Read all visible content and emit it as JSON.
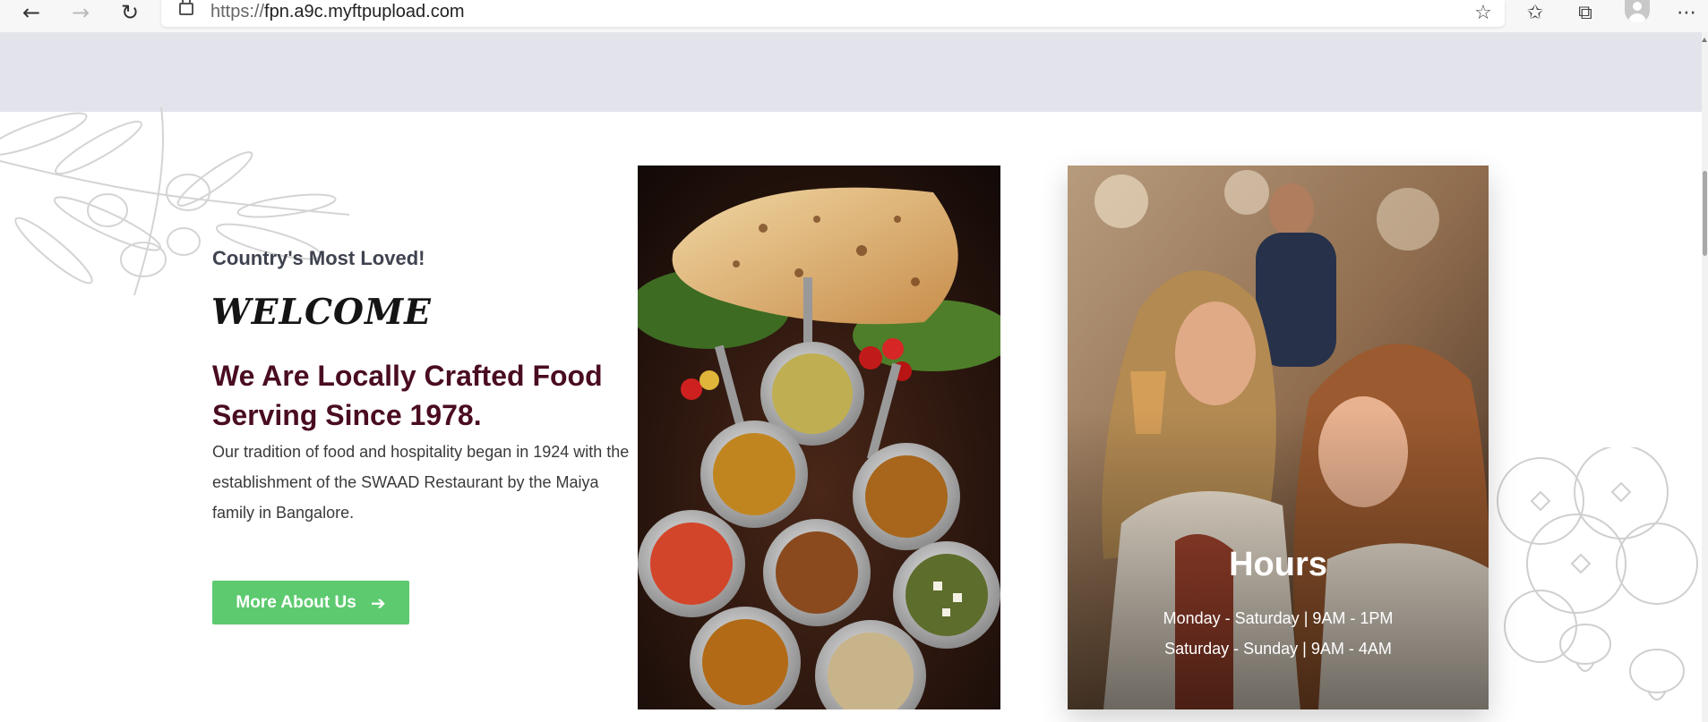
{
  "browser": {
    "back_icon": "arrow-left-icon",
    "forward_icon": "arrow-right-icon",
    "reload_icon": "reload-icon",
    "url_scheme": "https://",
    "url_host": "fpn.a9c.myftpupload.com",
    "favorites_add_icon": "star-plus-icon",
    "favorites_icon": "favorites-list-icon",
    "collections_icon": "collections-icon",
    "more_icon": "ellipsis-icon"
  },
  "about": {
    "subtitle": "Country's Most Loved!",
    "welcome": "WELCOME",
    "headline": "We Are Locally Crafted Food Serving Since 1978.",
    "body": "Our tradition of food and hospitality began in 1924 with the establishment of the SWAAD Restaurant by the Maiya family in Bangalore.",
    "cta_label": "More About Us",
    "cta_color": "#5dca6f",
    "headline_color": "#4a0c22"
  },
  "hours": {
    "title": "Hours",
    "weekdays": "Monday - Saturday | 9AM - 1PM",
    "weekend": "Saturday - Sunday | 9AM - 4AM"
  }
}
